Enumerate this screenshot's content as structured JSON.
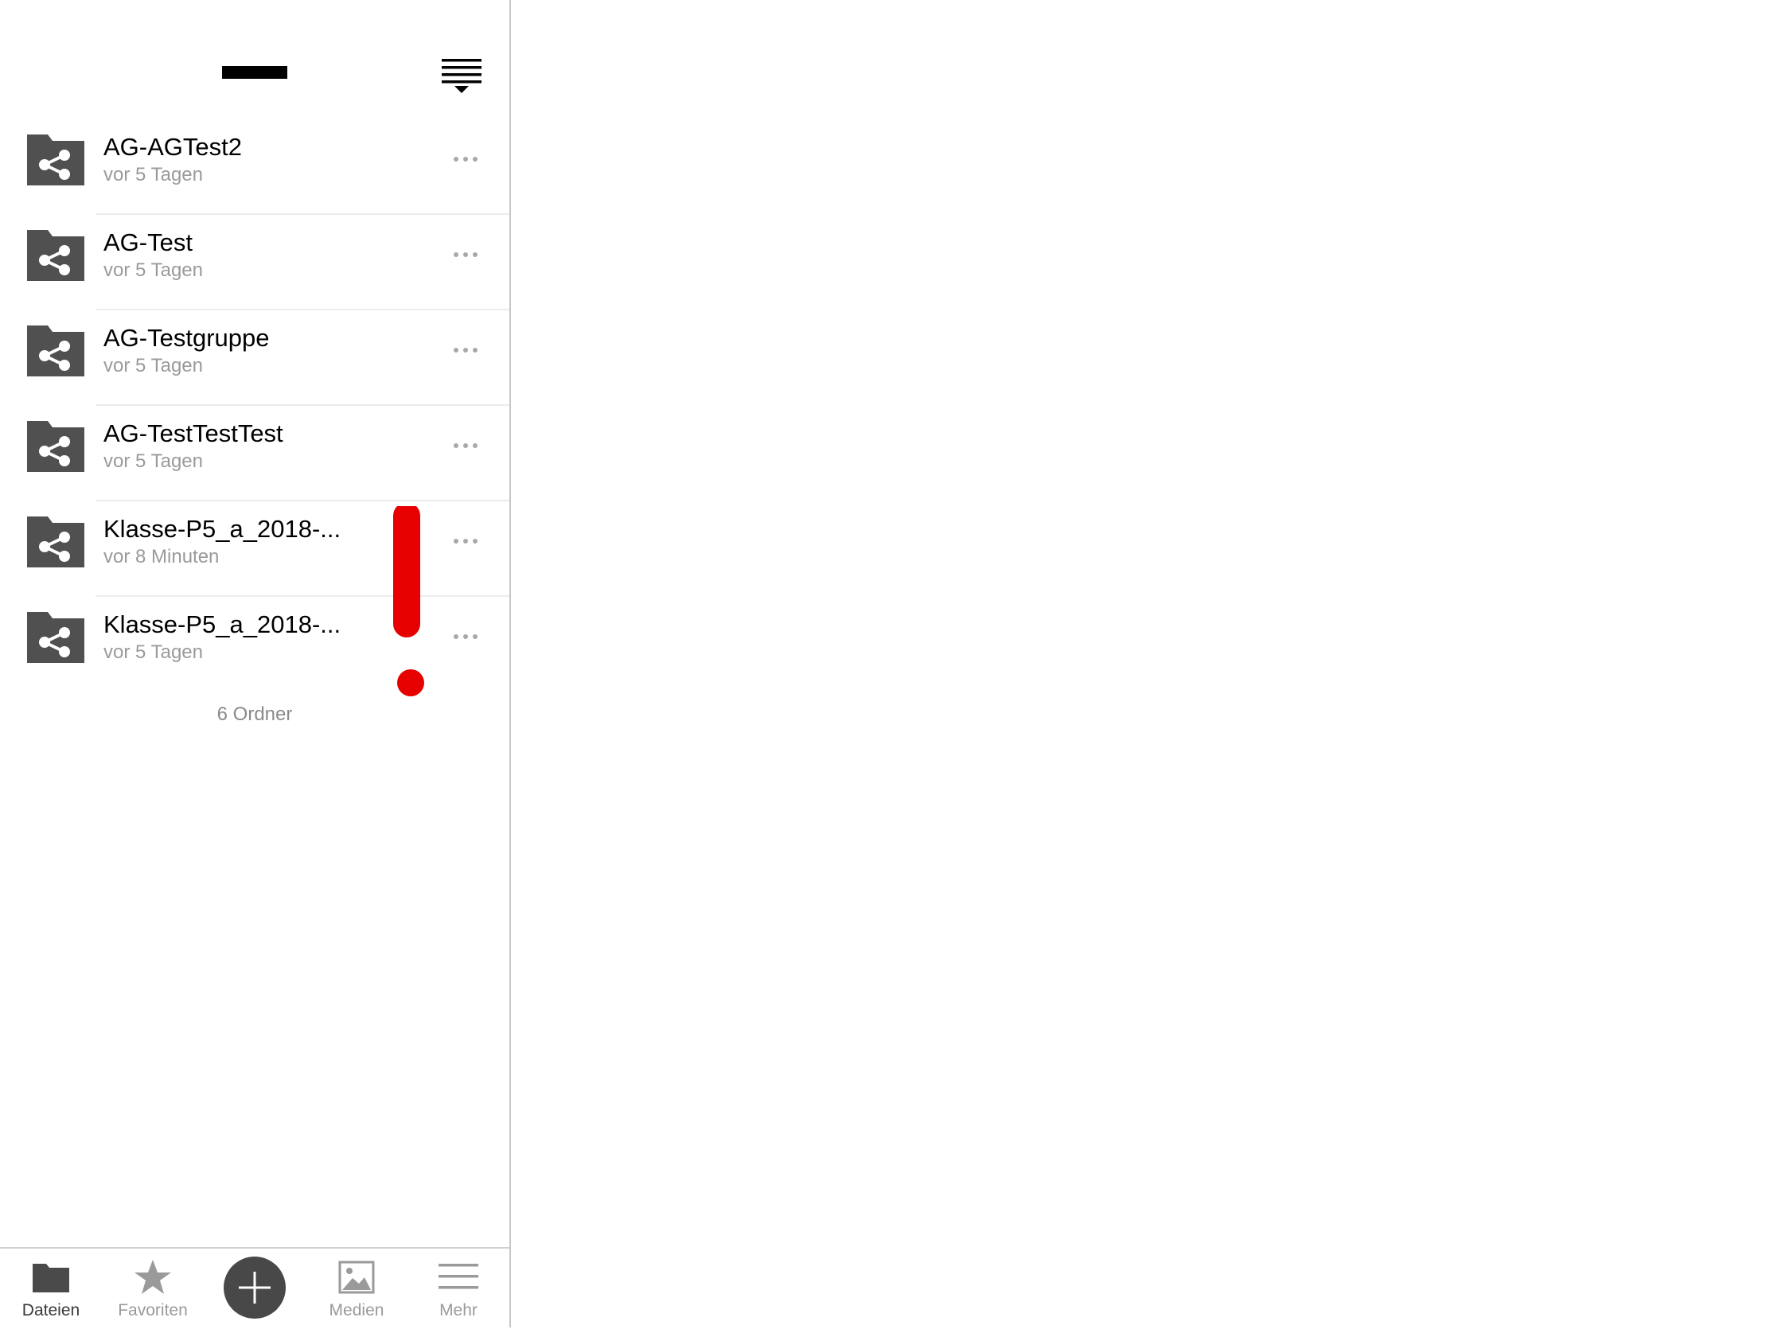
{
  "header": {
    "title_icon": "title-bar-icon",
    "sort_icon": "sort-list-icon"
  },
  "folders": [
    {
      "name": "AG-AGTest2",
      "date": "vor 5 Tagen"
    },
    {
      "name": "AG-Test",
      "date": "vor 5 Tagen"
    },
    {
      "name": "AG-Testgruppe",
      "date": "vor 5 Tagen"
    },
    {
      "name": "AG-TestTestTest",
      "date": "vor 5 Tagen"
    },
    {
      "name": "Klasse-P5_a_2018-...",
      "date": "vor 8 Minuten"
    },
    {
      "name": "Klasse-P5_a_2018-...",
      "date": "vor 5 Tagen"
    }
  ],
  "summary": "6 Ordner",
  "tabbar": {
    "files": "Dateien",
    "favorites": "Favoriten",
    "media": "Medien",
    "more": "Mehr"
  },
  "colors": {
    "folder_icon": "#505050",
    "annotation": "#e60000",
    "secondary_text": "#9a9a9a",
    "add_button": "#484848"
  }
}
